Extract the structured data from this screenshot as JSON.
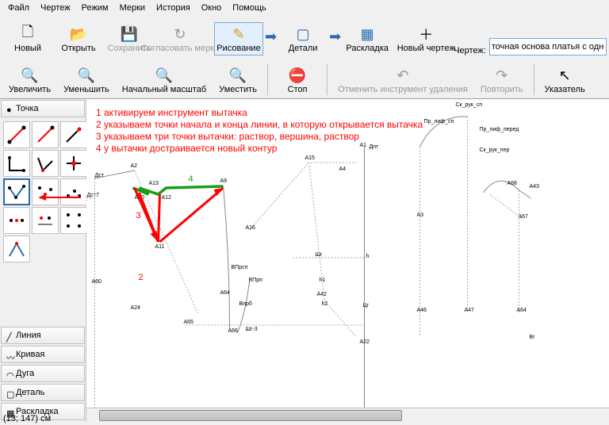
{
  "menu": [
    "Файл",
    "Чертеж",
    "Режим",
    "Мерки",
    "История",
    "Окно",
    "Помощь"
  ],
  "toolbar1": {
    "new": "Новый",
    "open": "Открыть",
    "save": "Сохранить",
    "agree": "Согласовать\nмерки",
    "draw": "Рисование",
    "detail": "Детали",
    "layout": "Раскладка",
    "newdraw": "Новый чертеж",
    "drawing_label": "Чертеж:",
    "drawing_value": "точная основа платья с одношовным рука"
  },
  "toolbar2": {
    "zoomin": "Увеличить",
    "zoomout": "Уменьшить",
    "zoomorig": "Начальный масштаб",
    "zoomfit": "Уместить",
    "stop": "Стоп",
    "undo_del": "Отменить инструмент удаления",
    "redo": "Повторить",
    "pointer": "Указатель"
  },
  "sidebar": {
    "point": "Точка",
    "line": "Линия",
    "curve": "Кривая",
    "arc": "Дуга",
    "detail": "Деталь",
    "layout": "Раскладка"
  },
  "arrow_note": "1",
  "instructions": [
    "1 активируем инструмент вытачка",
    "2 указываем точки начала и конца линии, в которую открывается вытачка",
    "3 указываем три точки вытачки: раствор, вершина, раствор",
    "4 у вытачки достраивается новый контур"
  ],
  "canvas_labels": {
    "Dst7": "Дст7",
    "Dst": "Дст",
    "A60": "А60",
    "A2": "А2",
    "A24": "А24",
    "A13": "А13",
    "A10": "А10",
    "A11": "А11",
    "A12": "А12",
    "A9": "А9",
    "A65": "А65",
    "A66": "А66",
    "Vprsp": "ВПрсп",
    "Vprp": "ВПрп",
    "Vprb": "Впрб",
    "A64": "А64",
    "ShrM": "Шг-3",
    "A16": "А16",
    "A15": "А15",
    "h1": "h1",
    "h2": "h2",
    "A42": "А42",
    "Shg": "Шг",
    "A1": "А1",
    "A4": "А4",
    "Dpt": "Дпт",
    "h": "h",
    "Cr": "Цг",
    "A22": "А22",
    "A3": "А3",
    "A46": "А46",
    "PrLifSp": "Пр_лиф_сп",
    "A47": "А47",
    "SkRukSp": "Ск_рук_сп",
    "SkRukPer": "Ск_рук_пер",
    "PrLifPered": "Пр_лиф_перед",
    "A43": "А43",
    "A68": "А68",
    "A67": "А67",
    "A64b": "А64",
    "Vg": "Вг",
    "g2": "2",
    "g3": "3",
    "g4": "4"
  },
  "status": "(13; 147) см"
}
